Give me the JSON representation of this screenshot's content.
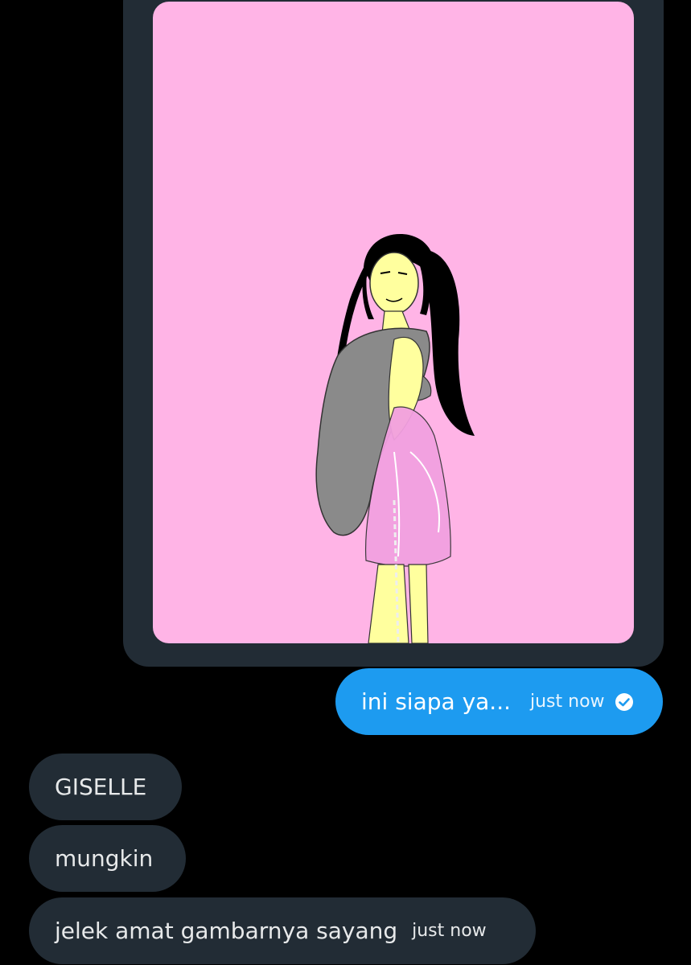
{
  "conversation": {
    "media": {
      "icon": "drawing-image",
      "background_color": "#ffb4e6"
    },
    "sent_message": {
      "text": "ini siapa ya...",
      "time": "just now",
      "status_icon": "check-circle-icon",
      "bubble_color": "#1d9bf0"
    },
    "received_messages": [
      {
        "text": "GISELLE"
      },
      {
        "text": "mungkin"
      },
      {
        "text": "jelek amat gambarnya sayang",
        "time": "just now"
      }
    ],
    "received_bubble_color": "#222c35"
  }
}
